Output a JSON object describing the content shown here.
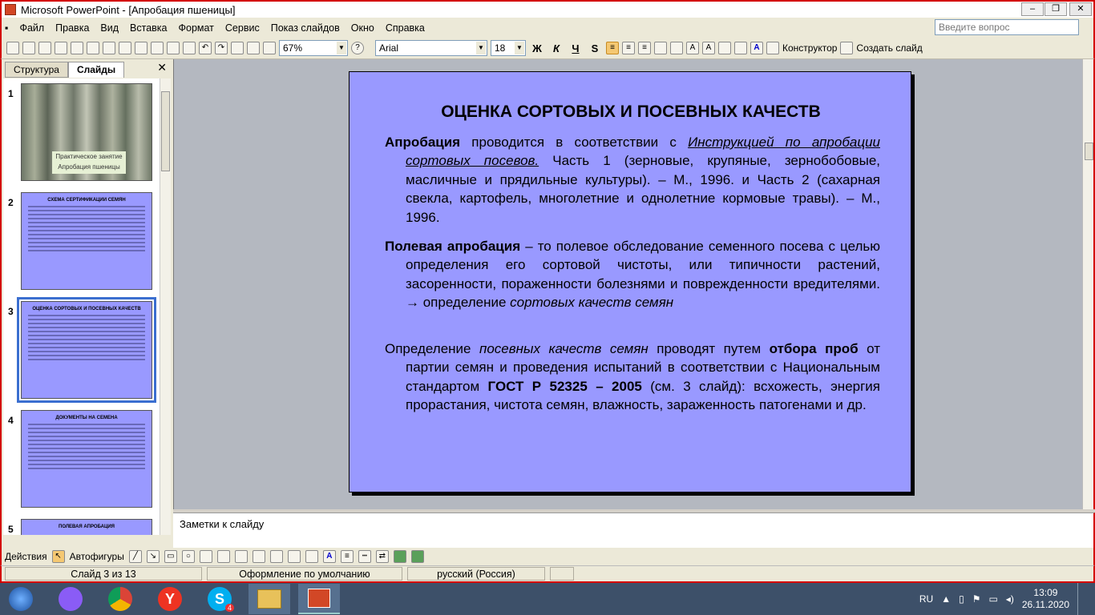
{
  "window": {
    "title": "Microsoft PowerPoint - [Апробация пшеницы]"
  },
  "menu": {
    "items": [
      "Файл",
      "Правка",
      "Вид",
      "Вставка",
      "Формат",
      "Сервис",
      "Показ слайдов",
      "Окно",
      "Справка"
    ],
    "ask_placeholder": "Введите вопрос"
  },
  "toolbar": {
    "zoom": "67%",
    "font": "Arial",
    "size": "18",
    "bold": "Ж",
    "italic": "К",
    "underline": "Ч",
    "shadow": "S",
    "designer": "Конструктор",
    "new_slide": "Создать слайд"
  },
  "panel": {
    "tab_outline": "Структура",
    "tab_slides": "Слайды",
    "thumbs": [
      {
        "num": "1",
        "caption_1": "Практическое занятие",
        "caption_2": "Апробация пшеницы"
      },
      {
        "num": "2",
        "title": "СХЕМА СЕРТИФИКАЦИИ СЕМЯН"
      },
      {
        "num": "3",
        "title": "ОЦЕНКА СОРТОВЫХ И ПОСЕВНЫХ КАЧЕСТВ"
      },
      {
        "num": "4",
        "title": "ДОКУМЕНТЫ НА СЕМЕНА"
      },
      {
        "num": "5",
        "title": "ПОЛЕВАЯ АПРОБАЦИЯ"
      }
    ]
  },
  "slide": {
    "title": "ОЦЕНКА СОРТОВЫХ И ПОСЕВНЫХ КАЧЕСТВ",
    "p1_bold": "Апробация",
    "p1_text1": " проводится в соответствии с ",
    "p1_link": "Инструкцией по апробации сортовых посевов.",
    "p1_text2": " Часть 1 (зерновые, крупяные, зернобобовые, масличные и прядильные культуры). – М., 1996. и Часть 2 (сахарная свекла, картофель, многолетние и однолетние кормовые травы). – М., 1996.",
    "p2_bold": "Полевая апробация",
    "p2_text": " – то полевое обследование семенного посева с целью определения его сортовой чистоты, или типичности растений, засоренности, пораженности болезнями и поврежденности вредителями. → определение ",
    "p2_italic": "сортовых качеств семян",
    "p3_text1": "Определение ",
    "p3_italic": "посевных качеств семян",
    "p3_text2": " проводят путем ",
    "p3_bold1": "отбора проб",
    "p3_text3": " от партии семян и проведения испытаний в соответствии с Национальным стандартом ",
    "p3_bold2": "ГОСТ Р 52325 – 2005",
    "p3_text4": " (см. 3 слайд): всхожесть, энергия прорастания, чистота семян, влажность, зараженность патогенами и др."
  },
  "notes": {
    "placeholder": "Заметки к слайду"
  },
  "drawing": {
    "actions": "Действия",
    "autoshapes": "Автофигуры"
  },
  "status": {
    "slide": "Слайд 3 из 13",
    "design": "Оформление по умолчанию",
    "language": "русский (Россия)"
  },
  "taskbar": {
    "lang": "RU",
    "time": "13:09",
    "date": "26.11.2020",
    "badge": "4"
  },
  "colors": {
    "slide_bg": "#9999ff",
    "accent_border": "#d40000",
    "taskbar": "#3d5069"
  }
}
